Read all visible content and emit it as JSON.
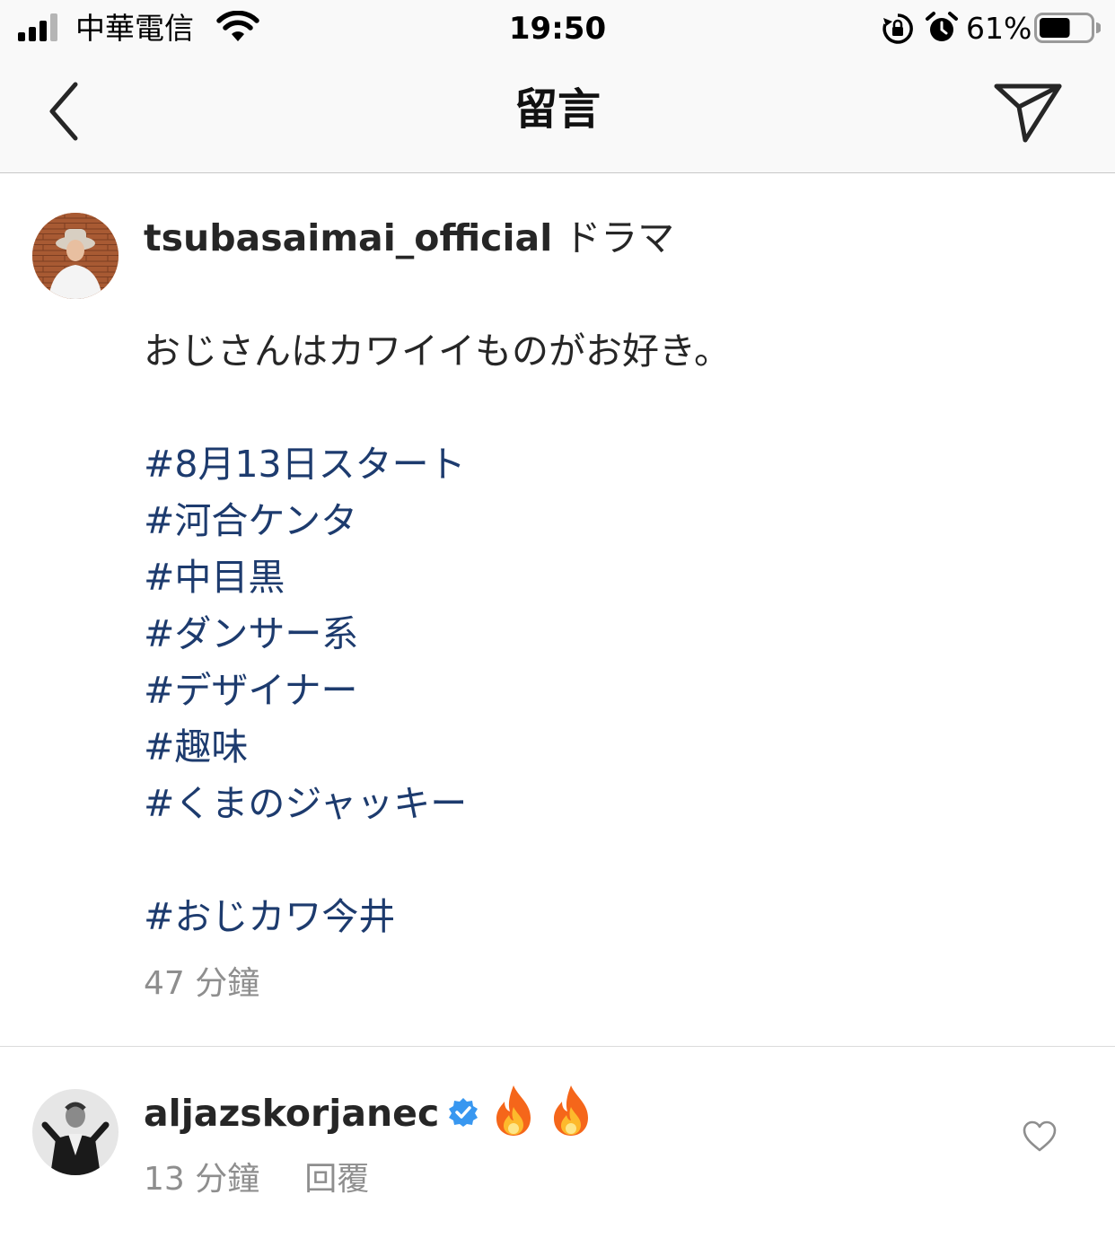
{
  "status_bar": {
    "carrier": "中華電信",
    "time": "19:50",
    "battery_percent": "61%",
    "battery_level": 0.61,
    "icons": [
      "signal-icon",
      "wifi-icon",
      "rotation-lock-icon",
      "alarm-icon",
      "battery-icon"
    ]
  },
  "nav": {
    "title": "留言",
    "back_icon": "chevron-left-icon",
    "send_icon": "paper-plane-icon"
  },
  "post": {
    "username": "tsubasaimai_official",
    "first_word": "ドラマ",
    "text_line": "おじさんはカワイイものがお好き。",
    "hashtags": [
      "#8月13日スタート",
      "#河合ケンタ",
      "#中目黒",
      "#ダンサー系",
      "#デザイナー",
      "#趣味",
      "#くまのジャッキー"
    ],
    "final_hashtag": "#おじカワ今井",
    "time_ago": "47 分鐘"
  },
  "comment": {
    "username": "aljazskorjanec",
    "verified": true,
    "emojis": [
      "fire-emoji",
      "fire-emoji"
    ],
    "time_ago": "13 分鐘",
    "reply_label": "回覆",
    "like_icon": "heart-outline-icon"
  },
  "colors": {
    "hashtag": "#1d3b6e",
    "muted": "#8e8e8e",
    "verified_blue": "#3897f0",
    "bar_bg": "#f9f9f9"
  }
}
